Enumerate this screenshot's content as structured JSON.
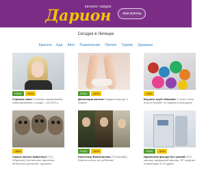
{
  "header": {
    "logo_tagline": "каталог скидок",
    "logo_name": "Дарион",
    "coupons_button": "мои купоны"
  },
  "page": {
    "title": "Сегодня в Липецке"
  },
  "categories": [
    "Красота",
    "Еда",
    "Авто",
    "Развлечения",
    "Прочее",
    "Туризм",
    "Здоровье"
  ],
  "deals": [
    {
      "free": "FREE",
      "discount": "-90%",
      "title": "Стрижки люкс!",
      "desc": "Сложное окрашивание, ламинирование и уходы – за 1000 р."
    },
    {
      "free": "FREE",
      "discount": "-60%",
      "title": "Депиляция воском",
      "desc": "Гладкая кожа до 4 недель"
    },
    {
      "free": "",
      "discount": "-54%",
      "title": "Боулинг-клуб «Москва»:",
      "desc": "1 или 2 часа игры в боулинг по будням и выходные"
    },
    {
      "free": "",
      "discount": "-48%",
      "title": "Самые милые животные!",
      "desc": "(ТЦ «Европа») Контактные животные, пятнистые рептилии, сурикаты"
    },
    {
      "free": "FREE",
      "discount": "-40%",
      "title": "Кинотеатр ВиниСинема",
      "desc": "(ТЦ Малибу). Билеты в кино по субботам!"
    },
    {
      "free": "FREE",
      "discount": "-90%",
      "title": "Идеальная фигура без усилий",
      "desc": "LPG-массаж, вакуумный массаж, RF-лифтинг и кавитация в «Студии»"
    }
  ]
}
